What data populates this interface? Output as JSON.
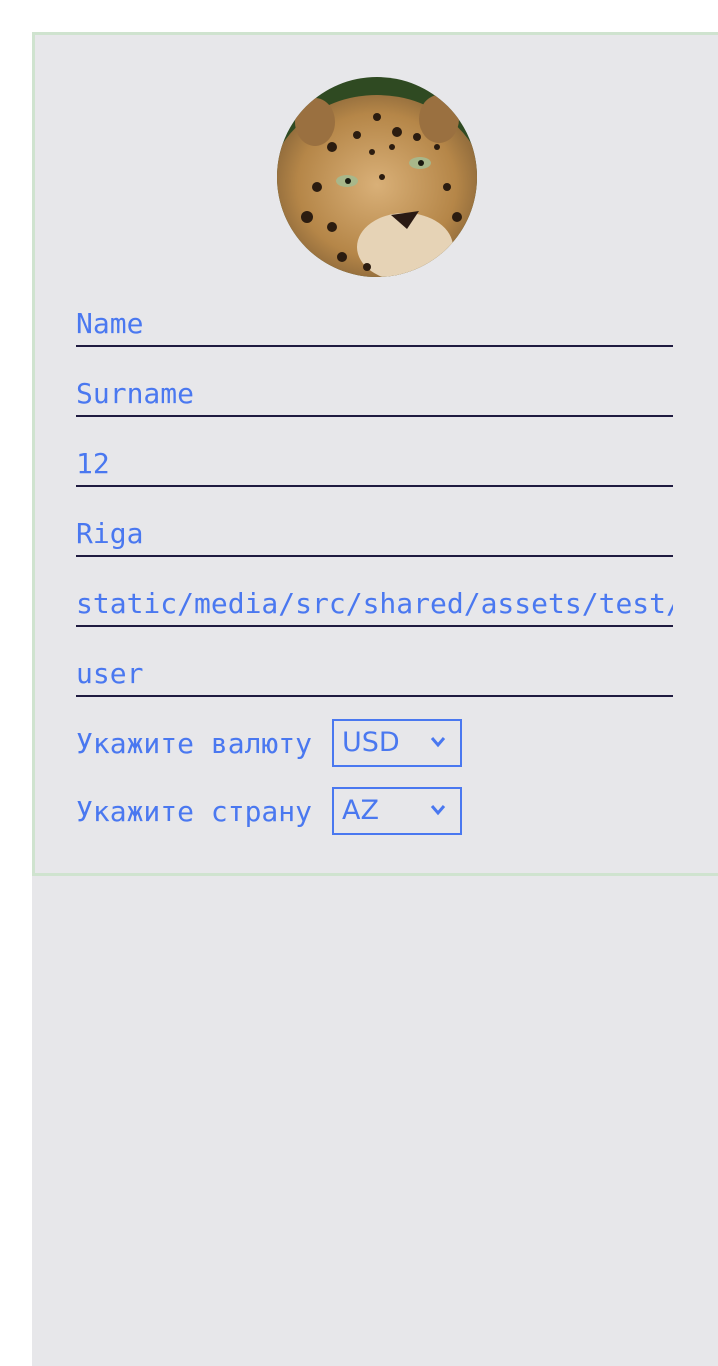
{
  "profile": {
    "avatar_alt": "leopard-avatar",
    "fields": [
      {
        "value": "Name"
      },
      {
        "value": "Surname"
      },
      {
        "value": "12"
      },
      {
        "value": "Riga"
      },
      {
        "value": "static/media/src/shared/assets/test/storybook.jpg"
      },
      {
        "value": "user"
      }
    ],
    "currency": {
      "label": "Укажите валюту",
      "selected": "USD"
    },
    "country": {
      "label": "Укажите страну",
      "selected": "AZ"
    }
  },
  "colors": {
    "accent": "#4a78f0",
    "underline": "#1f1b40",
    "background": "#e7e7ea",
    "card_border": "#cfe3cf"
  }
}
